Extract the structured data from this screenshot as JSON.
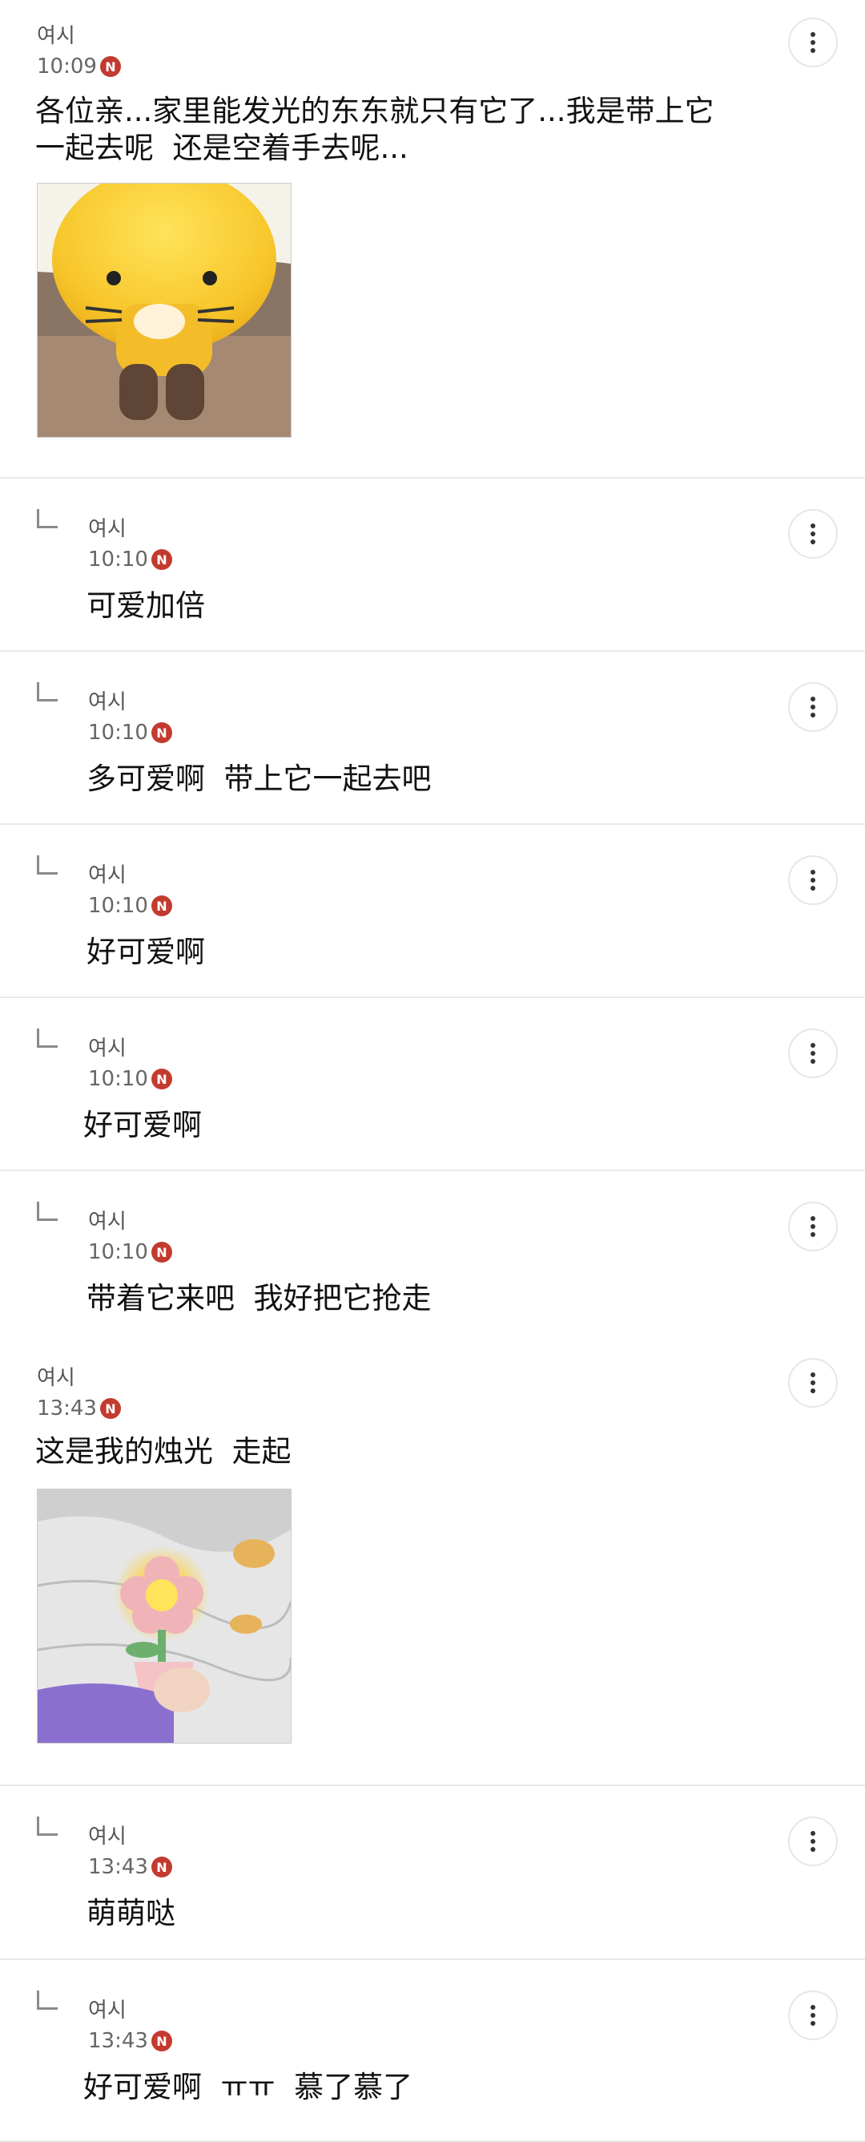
{
  "author_name": "여시",
  "new_badge": "N",
  "posts": [
    {
      "type": "top",
      "author": "여시",
      "time": "10:09",
      "text": "各位亲...家里能发光的东东就只有它了...我是带上它\n一起去呢  还是空着手去呢...",
      "image": "yellow-cat-lamp-photo"
    },
    {
      "type": "reply",
      "author": "여시",
      "time": "10:10",
      "text": "可爱加倍"
    },
    {
      "type": "reply",
      "author": "여시",
      "time": "10:10",
      "text": "多可爱啊  带上它一起去吧"
    },
    {
      "type": "reply",
      "author": "여시",
      "time": "10:10",
      "text": "好可爱啊"
    },
    {
      "type": "reply",
      "author": "여시",
      "time": "10:10",
      "text": "好可爱啊"
    },
    {
      "type": "reply",
      "author": "여시",
      "time": "10:10",
      "text": "带着它来吧  我好把它抢走"
    },
    {
      "type": "top",
      "author": "여시",
      "time": "13:43",
      "text": "这是我的烛光  走起",
      "image": "flower-candle-light-photo"
    },
    {
      "type": "reply",
      "author": "여시",
      "time": "13:43",
      "text": "萌萌哒"
    },
    {
      "type": "reply",
      "author": "여시",
      "time": "13:43",
      "text": "好可爱啊  ㅠㅠ  慕了慕了"
    }
  ],
  "colors": {
    "badge": "#c33a2f",
    "divider": "#e9e9e9",
    "text": "#111111",
    "meta": "#666666"
  }
}
